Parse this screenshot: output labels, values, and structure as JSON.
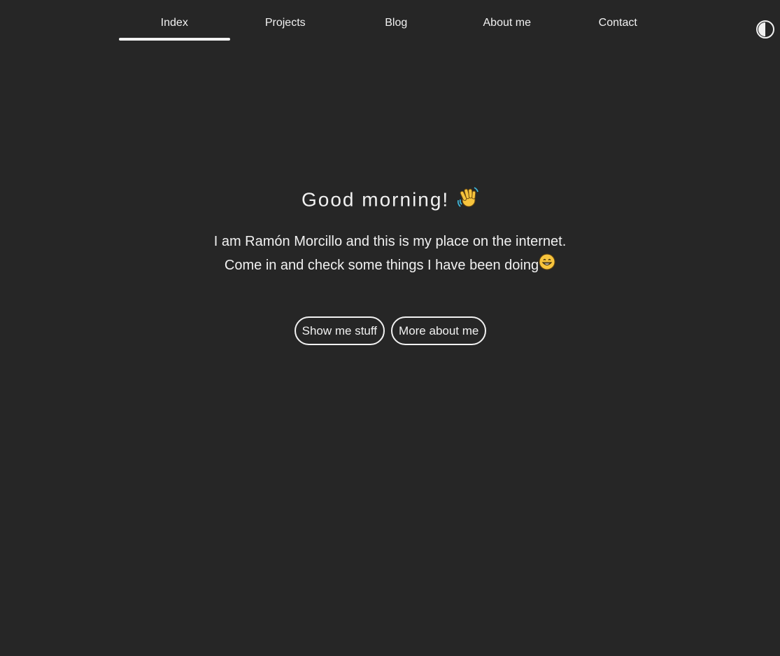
{
  "nav": {
    "items": [
      {
        "label": "Index",
        "active": true
      },
      {
        "label": "Projects",
        "active": false
      },
      {
        "label": "Blog",
        "active": false
      },
      {
        "label": "About me",
        "active": false
      },
      {
        "label": "Contact",
        "active": false
      }
    ],
    "theme_toggle_icon": "contrast-icon"
  },
  "hero": {
    "greeting": "Good morning!",
    "greeting_icon": "waving-hand-icon",
    "intro_line1": "I am Ramón Morcillo and this is my place on the internet.",
    "intro_line2": "Come in and check some things I have been doing",
    "intro_icon": "grinning-face-icon"
  },
  "actions": {
    "primary_label": "Show me stuff",
    "secondary_label": "More about me"
  },
  "colors": {
    "background": "#262626",
    "foreground": "#f1f1f1",
    "emoji_yellow": "#f7c43d"
  }
}
